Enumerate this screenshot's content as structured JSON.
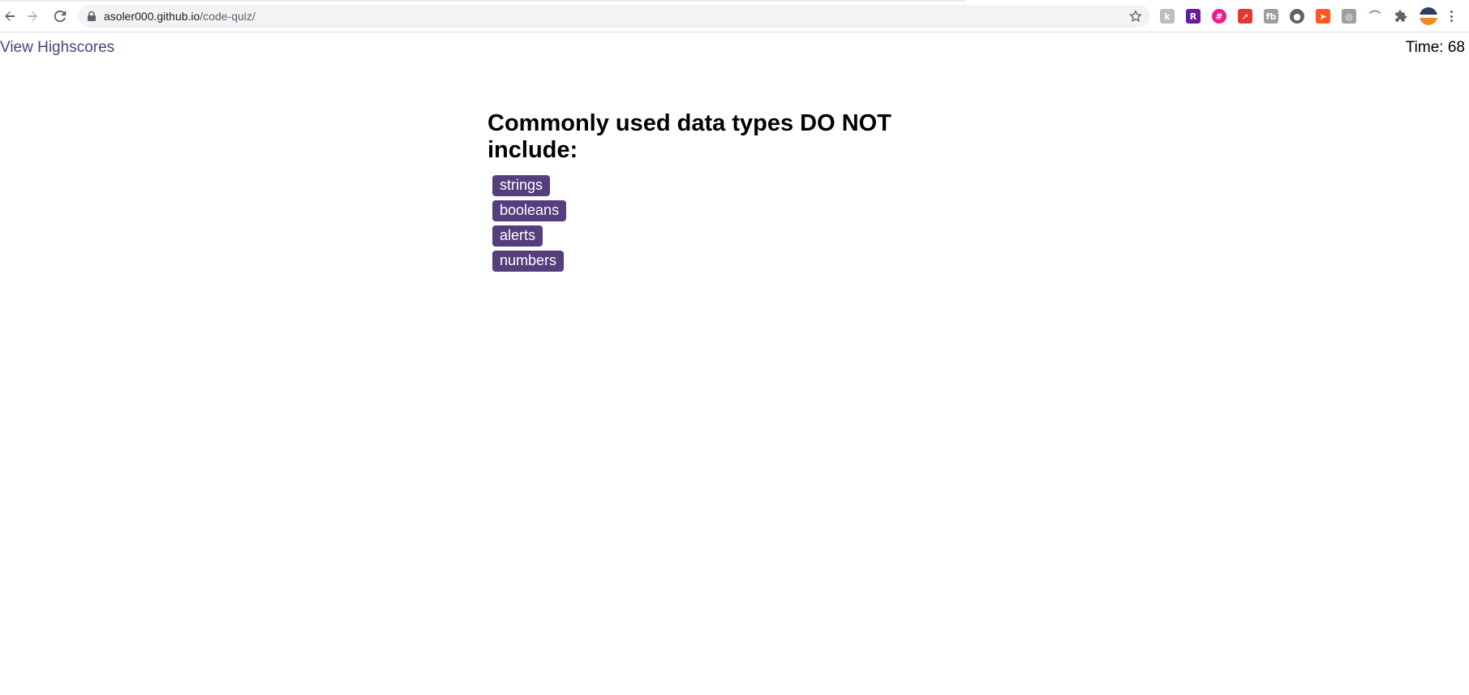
{
  "browser": {
    "url_host": "asoler000.github.io",
    "url_path": "/code-quiz/",
    "extensions": [
      {
        "icon": "k-extension-icon",
        "glyph": "k",
        "color": "#bdbdbd"
      },
      {
        "icon": "r-extension-icon",
        "glyph": "R",
        "color": "#6a1b9a"
      },
      {
        "icon": "hash-extension-icon",
        "glyph": "#",
        "color": "#e91e8c"
      },
      {
        "icon": "rocket-extension-icon",
        "glyph": "➚",
        "color": "#e53935"
      },
      {
        "icon": "fb-extension-icon",
        "glyph": "fb",
        "color": "#9e9e9e"
      },
      {
        "icon": "circle-extension-icon",
        "glyph": "●",
        "color": "#616161"
      },
      {
        "icon": "arrow-extension-icon",
        "glyph": "➤",
        "color": "#ff5722"
      },
      {
        "icon": "gray-extension-icon",
        "glyph": "◎",
        "color": "#9e9e9e"
      },
      {
        "icon": "rainbow-extension-icon",
        "glyph": "⌒",
        "color": "#43a047"
      }
    ],
    "accent": "#563d7c"
  },
  "header": {
    "highscores_label": "View Highscores",
    "timer_text": "Time: 68"
  },
  "quiz": {
    "question": "Commonly used data types DO NOT include:",
    "choices": [
      "strings",
      "booleans",
      "alerts",
      "numbers"
    ]
  }
}
